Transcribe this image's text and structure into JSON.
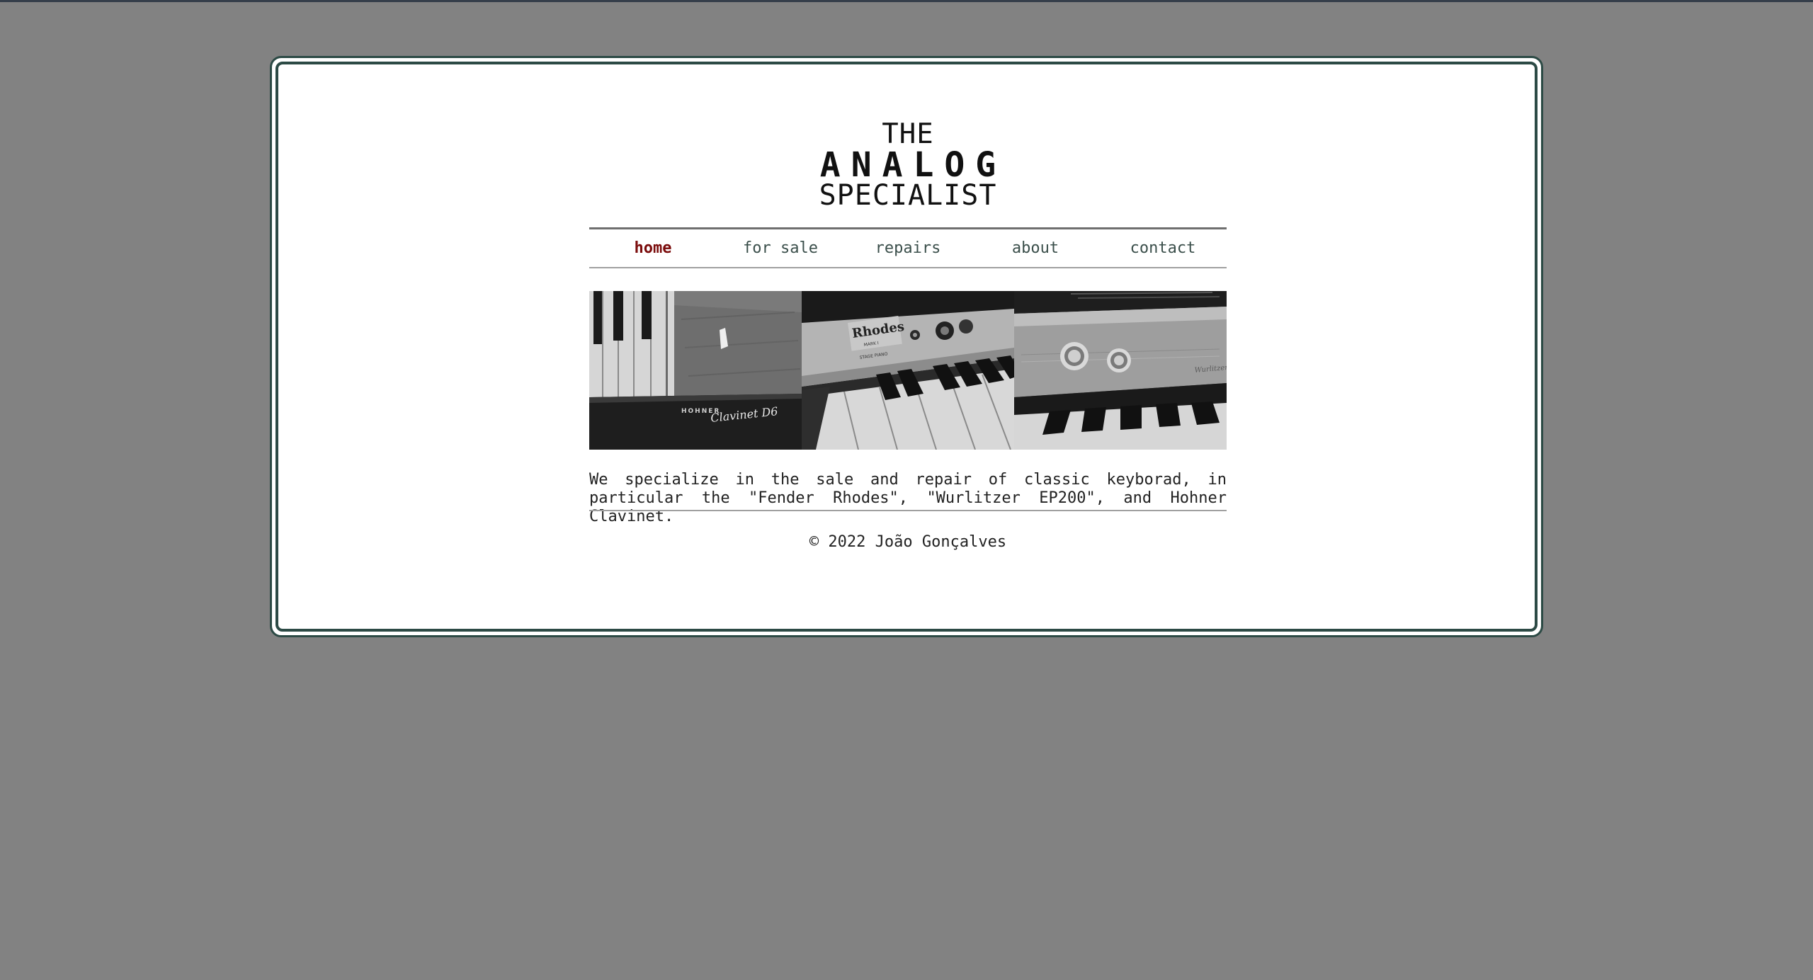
{
  "logo": {
    "line1": "THE",
    "line2": "ANALOG",
    "line3": "SPECIALIST"
  },
  "nav": {
    "items": [
      {
        "label": "home"
      },
      {
        "label": "for sale"
      },
      {
        "label": "repairs"
      },
      {
        "label": "about"
      },
      {
        "label": "contact"
      }
    ],
    "active": "home"
  },
  "photos": {
    "items": [
      {
        "brand": "HOHNER",
        "model": "Clavinet D6"
      },
      {
        "brand": "Rhodes",
        "model": "MARK I",
        "subtitle": "STAGE PIANO"
      },
      {
        "brand": "Wurlitzer"
      }
    ]
  },
  "main": {
    "description": "We specialize in the sale and repair of classic keyborad, in particular the \"Fender Rhodes\", \"Wurlitzer EP200\", and Hohner Clavinet."
  },
  "footer": {
    "copyright": "© 2022 João Gonçalves"
  },
  "colors": {
    "page_bg": "#828282",
    "frame_border": "#2c4a45",
    "nav_text": "#3b4f4b",
    "nav_active": "#7a0b0b"
  }
}
